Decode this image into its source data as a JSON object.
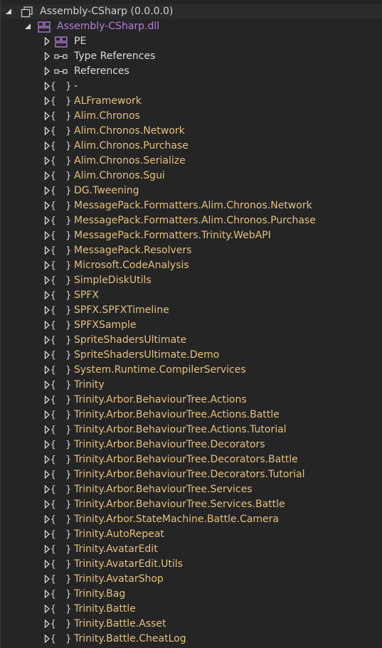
{
  "root": {
    "label": "Assembly-CSharp (0.0.0.0)",
    "expanded": true,
    "icon": "assembly-icon"
  },
  "dll": {
    "label": "Assembly-CSharp.dll",
    "expanded": true,
    "icon": "module-icon"
  },
  "special_items": [
    {
      "label": "PE",
      "icon": "pe-icon"
    },
    {
      "label": "Type References",
      "icon": "references-icon"
    },
    {
      "label": "References",
      "icon": "references-icon"
    }
  ],
  "namespaces": [
    "-",
    "ALFramework",
    "Alim.Chronos",
    "Alim.Chronos.Network",
    "Alim.Chronos.Purchase",
    "Alim.Chronos.Serialize",
    "Alim.Chronos.Sgui",
    "DG.Tweening",
    "MessagePack.Formatters.Alim.Chronos.Network",
    "MessagePack.Formatters.Alim.Chronos.Purchase",
    "MessagePack.Formatters.Trinity.WebAPI",
    "MessagePack.Resolvers",
    "Microsoft.CodeAnalysis",
    "SimpleDiskUtils",
    "SPFX",
    "SPFX.SPFXTimeline",
    "SPFXSample",
    "SpriteShadersUltimate",
    "SpriteShadersUltimate.Demo",
    "System.Runtime.CompilerServices",
    "Trinity",
    "Trinity.Arbor.BehaviourTree.Actions",
    "Trinity.Arbor.BehaviourTree.Actions.Battle",
    "Trinity.Arbor.BehaviourTree.Actions.Tutorial",
    "Trinity.Arbor.BehaviourTree.Decorators",
    "Trinity.Arbor.BehaviourTree.Decorators.Battle",
    "Trinity.Arbor.BehaviourTree.Decorators.Tutorial",
    "Trinity.Arbor.BehaviourTree.Services",
    "Trinity.Arbor.BehaviourTree.Services.Battle",
    "Trinity.Arbor.StateMachine.Battle.Camera",
    "Trinity.AutoRepeat",
    "Trinity.AvatarEdit",
    "Trinity.AvatarEdit.Utils",
    "Trinity.AvatarShop",
    "Trinity.Bag",
    "Trinity.Battle",
    "Trinity.Battle.Asset",
    "Trinity.Battle.CheatLog"
  ],
  "namespace_icon": "{ }",
  "colors": {
    "background": "#252526",
    "namespace_text": "#e5c07b",
    "dll_text": "#b180d7",
    "plain_text": "#dcdcdc"
  }
}
